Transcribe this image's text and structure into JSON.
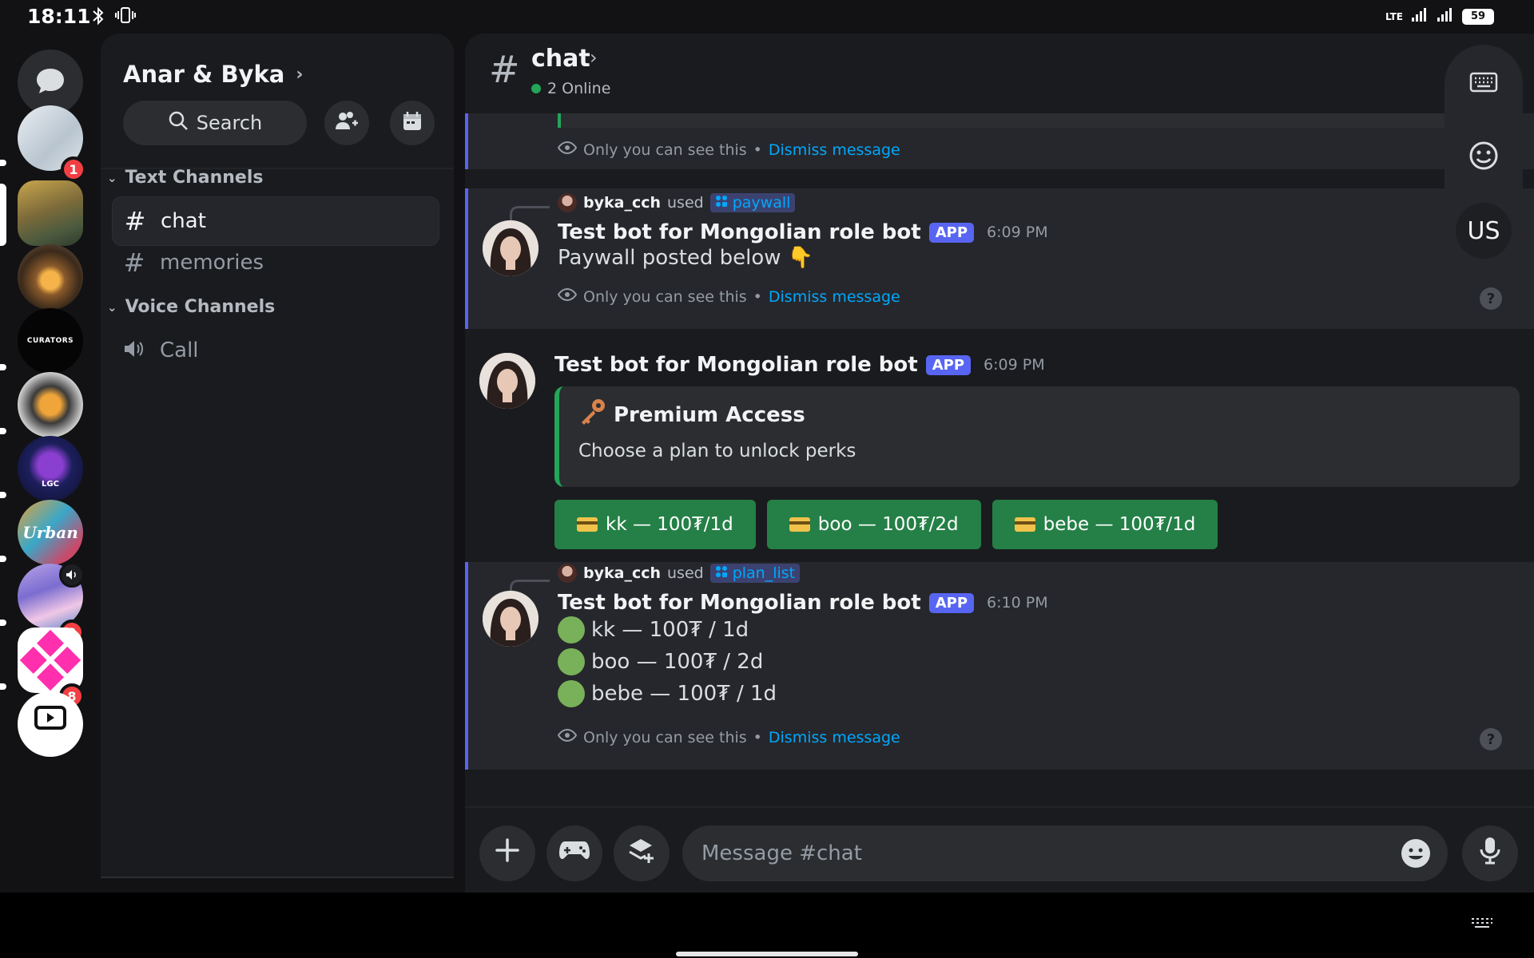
{
  "status_bar": {
    "time": "18:11",
    "network_label": "LTE",
    "battery": "59"
  },
  "servers": [
    {
      "name": "server-1",
      "badge": "1"
    },
    {
      "name": "server-2",
      "badge": ""
    },
    {
      "name": "server-3",
      "badge": ""
    },
    {
      "name": "server-4",
      "label": "CURATORS",
      "badge": ""
    },
    {
      "name": "server-5",
      "badge": ""
    },
    {
      "name": "server-6",
      "label": "LGC",
      "badge": ""
    },
    {
      "name": "server-7",
      "label": "Urban",
      "badge": ""
    },
    {
      "name": "server-8",
      "badge": "2"
    },
    {
      "name": "server-9",
      "badge": "8"
    }
  ],
  "sidebar": {
    "guild_name": "Anar & Byka",
    "search_label": "Search",
    "categories": [
      {
        "label": "Text Channels"
      },
      {
        "label": "Voice Channels"
      }
    ],
    "channels": [
      {
        "label": "chat"
      },
      {
        "label": "memories"
      },
      {
        "label": "Call"
      }
    ]
  },
  "header": {
    "channel_name": "chat",
    "online": "2 Online"
  },
  "ephemeral": {
    "only_you": "Only you can see this",
    "separator": "•",
    "dismiss": "Dismiss message"
  },
  "messages": [
    {
      "reply_user": "byka_cch",
      "used": "used",
      "command": "paywall",
      "author": "Test bot for Mongolian role bot",
      "tag": "APP",
      "time": "6:09 PM",
      "text": "Paywall posted below 👇"
    },
    {
      "author": "Test bot for Mongolian role bot",
      "tag": "APP",
      "time": "6:09 PM",
      "embed_title": "Premium Access",
      "embed_desc": "Choose a plan to unlock perks",
      "buttons": [
        "kk — 100₮/1d",
        "boo — 100₮/2d",
        "bebe — 100₮/1d"
      ]
    },
    {
      "reply_user": "byka_cch",
      "used": "used",
      "command": "plan_list",
      "author": "Test bot for Mongolian role bot",
      "tag": "APP",
      "time": "6:10 PM",
      "lines": [
        "kk — 100₮ / 1d",
        "boo — 100₮ / 2d",
        "bebe — 100₮ / 1d"
      ]
    }
  ],
  "composer": {
    "placeholder": "Message #chat"
  },
  "keyboard_panel": {
    "language": "US"
  },
  "colors": {
    "accent": "#5865f2",
    "button_green": "#248046",
    "link": "#00a8fc",
    "badge_red": "#f23f43"
  }
}
